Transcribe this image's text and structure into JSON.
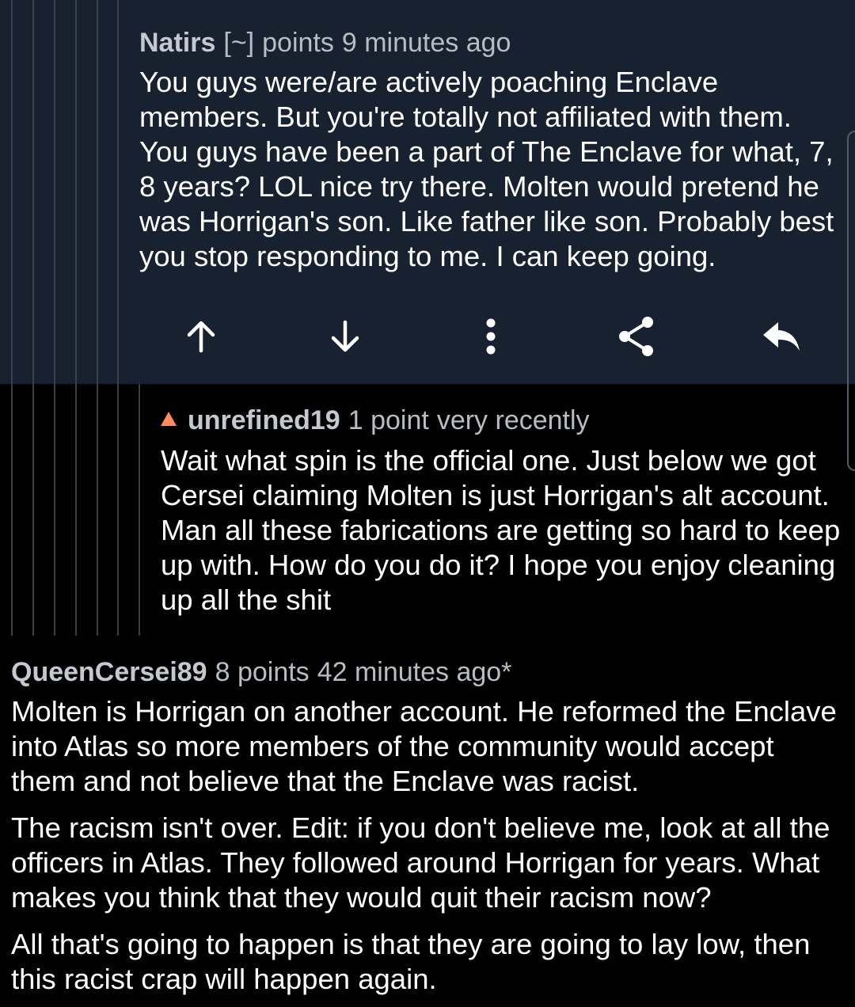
{
  "colors": {
    "background": "#000000",
    "selected_background": "#17212f",
    "thread_line": "#3a3f48",
    "meta_text": "#b8bcc3",
    "body_text": "#ffffff",
    "upvote_accent": "#ff8b60"
  },
  "comments": [
    {
      "author": "Natirs",
      "flair": "[~]",
      "score": "points",
      "time": "9 minutes ago",
      "body": [
        "You guys were/are actively poaching Enclave members. But you're totally not affiliated with them. You guys have been a part of The Enclave for what, 7, 8 years? LOL nice try there. Molten would pretend he was Horrigan's son. Like father like son. Probably best you stop responding to me. I can keep going."
      ],
      "selected": true
    },
    {
      "author": "unrefined19",
      "vote_icon": "upvoted-arrow-icon",
      "score": "1 point",
      "time": "very recently",
      "body": [
        "Wait what spin is the official one. Just below we got Cersei claiming Molten is just Horrigan's alt account. Man all these fabrications are getting so hard to keep up with. How do you do it? I hope you enjoy cleaning up all the shit"
      ]
    },
    {
      "author": "QueenCersei89",
      "score": "8 points",
      "time": "42 minutes ago*",
      "body": [
        "Molten is Horrigan on another account. He reformed the Enclave into Atlas so more members of the community would accept them and not believe that the Enclave was racist.",
        "The racism isn't over. Edit: if you don't believe me, look at all the officers in Atlas. They followed around Horrigan for years. What makes you think that they would quit their racism now?",
        "All that's going to happen is that they are going to lay low, then this racist crap will happen again."
      ]
    }
  ],
  "actions": [
    {
      "name": "upvote",
      "icon": "arrow-up-icon"
    },
    {
      "name": "downvote",
      "icon": "arrow-down-icon"
    },
    {
      "name": "more",
      "icon": "more-vertical-icon"
    },
    {
      "name": "share",
      "icon": "share-icon"
    },
    {
      "name": "reply",
      "icon": "reply-icon"
    }
  ]
}
